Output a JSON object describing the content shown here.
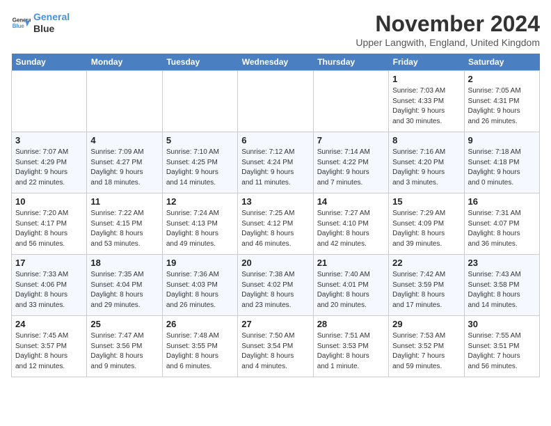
{
  "header": {
    "logo_line1": "General",
    "logo_line2": "Blue",
    "month_title": "November 2024",
    "location": "Upper Langwith, England, United Kingdom"
  },
  "days_of_week": [
    "Sunday",
    "Monday",
    "Tuesday",
    "Wednesday",
    "Thursday",
    "Friday",
    "Saturday"
  ],
  "weeks": [
    [
      {
        "day": "",
        "info": ""
      },
      {
        "day": "",
        "info": ""
      },
      {
        "day": "",
        "info": ""
      },
      {
        "day": "",
        "info": ""
      },
      {
        "day": "",
        "info": ""
      },
      {
        "day": "1",
        "info": "Sunrise: 7:03 AM\nSunset: 4:33 PM\nDaylight: 9 hours\nand 30 minutes."
      },
      {
        "day": "2",
        "info": "Sunrise: 7:05 AM\nSunset: 4:31 PM\nDaylight: 9 hours\nand 26 minutes."
      }
    ],
    [
      {
        "day": "3",
        "info": "Sunrise: 7:07 AM\nSunset: 4:29 PM\nDaylight: 9 hours\nand 22 minutes."
      },
      {
        "day": "4",
        "info": "Sunrise: 7:09 AM\nSunset: 4:27 PM\nDaylight: 9 hours\nand 18 minutes."
      },
      {
        "day": "5",
        "info": "Sunrise: 7:10 AM\nSunset: 4:25 PM\nDaylight: 9 hours\nand 14 minutes."
      },
      {
        "day": "6",
        "info": "Sunrise: 7:12 AM\nSunset: 4:24 PM\nDaylight: 9 hours\nand 11 minutes."
      },
      {
        "day": "7",
        "info": "Sunrise: 7:14 AM\nSunset: 4:22 PM\nDaylight: 9 hours\nand 7 minutes."
      },
      {
        "day": "8",
        "info": "Sunrise: 7:16 AM\nSunset: 4:20 PM\nDaylight: 9 hours\nand 3 minutes."
      },
      {
        "day": "9",
        "info": "Sunrise: 7:18 AM\nSunset: 4:18 PM\nDaylight: 9 hours\nand 0 minutes."
      }
    ],
    [
      {
        "day": "10",
        "info": "Sunrise: 7:20 AM\nSunset: 4:17 PM\nDaylight: 8 hours\nand 56 minutes."
      },
      {
        "day": "11",
        "info": "Sunrise: 7:22 AM\nSunset: 4:15 PM\nDaylight: 8 hours\nand 53 minutes."
      },
      {
        "day": "12",
        "info": "Sunrise: 7:24 AM\nSunset: 4:13 PM\nDaylight: 8 hours\nand 49 minutes."
      },
      {
        "day": "13",
        "info": "Sunrise: 7:25 AM\nSunset: 4:12 PM\nDaylight: 8 hours\nand 46 minutes."
      },
      {
        "day": "14",
        "info": "Sunrise: 7:27 AM\nSunset: 4:10 PM\nDaylight: 8 hours\nand 42 minutes."
      },
      {
        "day": "15",
        "info": "Sunrise: 7:29 AM\nSunset: 4:09 PM\nDaylight: 8 hours\nand 39 minutes."
      },
      {
        "day": "16",
        "info": "Sunrise: 7:31 AM\nSunset: 4:07 PM\nDaylight: 8 hours\nand 36 minutes."
      }
    ],
    [
      {
        "day": "17",
        "info": "Sunrise: 7:33 AM\nSunset: 4:06 PM\nDaylight: 8 hours\nand 33 minutes."
      },
      {
        "day": "18",
        "info": "Sunrise: 7:35 AM\nSunset: 4:04 PM\nDaylight: 8 hours\nand 29 minutes."
      },
      {
        "day": "19",
        "info": "Sunrise: 7:36 AM\nSunset: 4:03 PM\nDaylight: 8 hours\nand 26 minutes."
      },
      {
        "day": "20",
        "info": "Sunrise: 7:38 AM\nSunset: 4:02 PM\nDaylight: 8 hours\nand 23 minutes."
      },
      {
        "day": "21",
        "info": "Sunrise: 7:40 AM\nSunset: 4:01 PM\nDaylight: 8 hours\nand 20 minutes."
      },
      {
        "day": "22",
        "info": "Sunrise: 7:42 AM\nSunset: 3:59 PM\nDaylight: 8 hours\nand 17 minutes."
      },
      {
        "day": "23",
        "info": "Sunrise: 7:43 AM\nSunset: 3:58 PM\nDaylight: 8 hours\nand 14 minutes."
      }
    ],
    [
      {
        "day": "24",
        "info": "Sunrise: 7:45 AM\nSunset: 3:57 PM\nDaylight: 8 hours\nand 12 minutes."
      },
      {
        "day": "25",
        "info": "Sunrise: 7:47 AM\nSunset: 3:56 PM\nDaylight: 8 hours\nand 9 minutes."
      },
      {
        "day": "26",
        "info": "Sunrise: 7:48 AM\nSunset: 3:55 PM\nDaylight: 8 hours\nand 6 minutes."
      },
      {
        "day": "27",
        "info": "Sunrise: 7:50 AM\nSunset: 3:54 PM\nDaylight: 8 hours\nand 4 minutes."
      },
      {
        "day": "28",
        "info": "Sunrise: 7:51 AM\nSunset: 3:53 PM\nDaylight: 8 hours\nand 1 minute."
      },
      {
        "day": "29",
        "info": "Sunrise: 7:53 AM\nSunset: 3:52 PM\nDaylight: 7 hours\nand 59 minutes."
      },
      {
        "day": "30",
        "info": "Sunrise: 7:55 AM\nSunset: 3:51 PM\nDaylight: 7 hours\nand 56 minutes."
      }
    ]
  ]
}
